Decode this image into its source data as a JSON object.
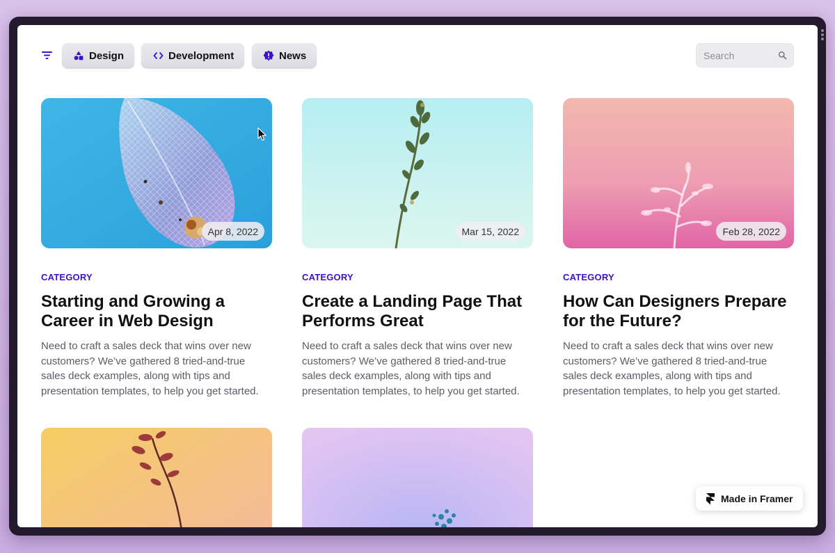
{
  "colors": {
    "accent": "#3c12c9",
    "page_bg": "#ffffff",
    "frame": "#231a2e"
  },
  "filters": {
    "icon": "filter-icon",
    "chips": [
      {
        "label": "Design",
        "icon": "shapes-icon"
      },
      {
        "label": "Development",
        "icon": "code-icon"
      },
      {
        "label": "News",
        "icon": "badge-icon"
      }
    ]
  },
  "search": {
    "placeholder": "Search",
    "value": "",
    "icon": "search-icon"
  },
  "posts": [
    {
      "date": "Apr 8, 2022",
      "category": "CATEGORY",
      "title": "Starting and Growing a Career in Web Design",
      "description": "Need to craft a sales deck that wins over new customers? We’ve gathered 8 tried-and-true sales deck examples, along with tips and presentation templates, to help you get started."
    },
    {
      "date": "Mar 15, 2022",
      "category": "CATEGORY",
      "title": "Create a Landing Page That Performs Great",
      "description": "Need to craft a sales deck that wins over new customers? We’ve gathered 8 tried-and-true sales deck examples, along with tips and presentation templates, to help you get started."
    },
    {
      "date": "Feb 28, 2022",
      "category": "CATEGORY",
      "title": "How Can Designers Prepare for the Future?",
      "description": "Need to craft a sales deck that wins over new customers? We’ve gathered 8 tried-and-true sales deck examples, along with tips and presentation templates, to help you get started."
    }
  ],
  "badge": {
    "label": "Made in Framer",
    "icon": "framer-logo-icon"
  }
}
